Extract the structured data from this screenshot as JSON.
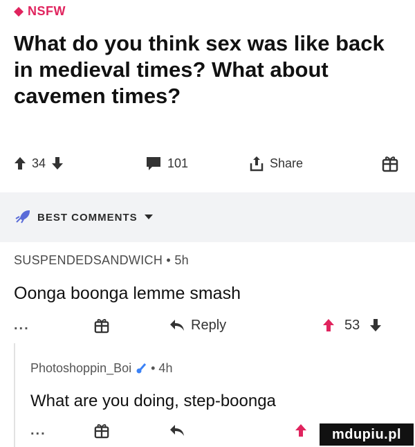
{
  "post": {
    "nsfw_label": "NSFW",
    "title": "What do you think sex was like back in medieval times? What about cavemen times?",
    "upvotes": "34",
    "comments": "101",
    "share_label": "Share"
  },
  "best_comments": {
    "label": "BEST COMMENTS"
  },
  "comment": {
    "username": "SUSPENDEDSANDWICH • 5h",
    "text": "Oonga boonga lemme smash",
    "more_label": "...",
    "reply_label": "Reply",
    "upvotes": "53"
  },
  "reply": {
    "username": "Photoshoppin_Boi",
    "meta": "• 4h",
    "text": "What are you doing, step-boonga",
    "more_label": "..."
  },
  "watermark": {
    "text": "mdupiu.pl"
  },
  "colors": {
    "nsfw": "#e0245e",
    "text": "#1a1a1a",
    "divider_bg": "#f2f3f5"
  }
}
